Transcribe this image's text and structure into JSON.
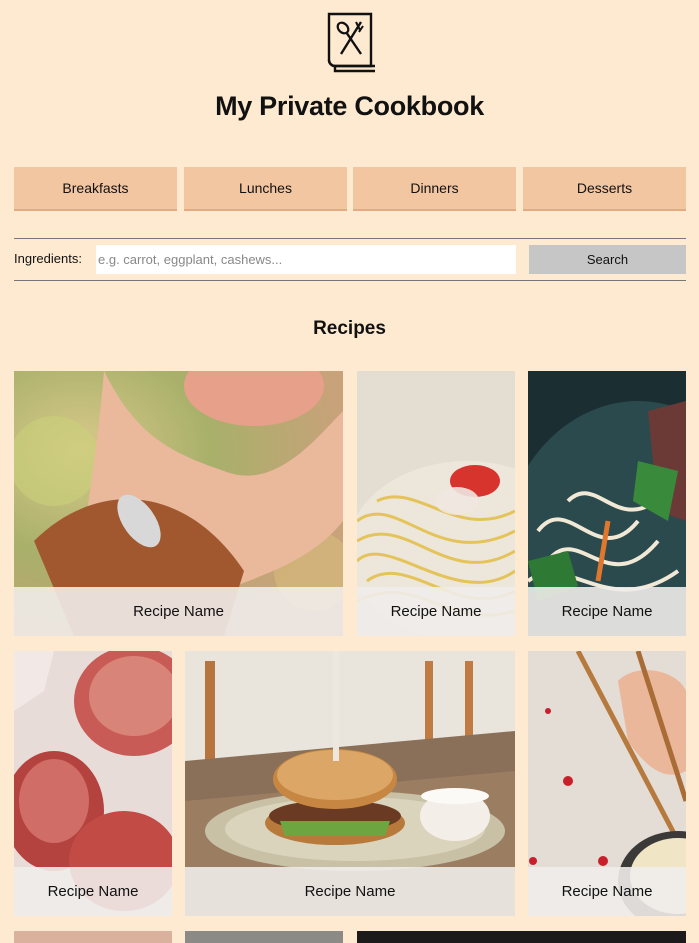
{
  "header": {
    "logo_icon": "cookbook-icon",
    "title": "My Private Cookbook"
  },
  "categories": [
    {
      "label": "Breakfasts"
    },
    {
      "label": "Lunches"
    },
    {
      "label": "Dinners"
    },
    {
      "label": "Desserts"
    }
  ],
  "search": {
    "label": "Ingredients:",
    "placeholder": "e.g. carrot, eggplant, cashews...",
    "value": "",
    "button_label": "Search"
  },
  "recipes": {
    "title": "Recipes",
    "items": [
      {
        "name": "Recipe Name",
        "photo": "peach-in-hand"
      },
      {
        "name": "Recipe Name",
        "photo": "spaghetti"
      },
      {
        "name": "Recipe Name",
        "photo": "noodle-bowl"
      },
      {
        "name": "Recipe Name",
        "photo": "crab"
      },
      {
        "name": "Recipe Name",
        "photo": "burger"
      },
      {
        "name": "Recipe Name",
        "photo": "chopsticks-noodles"
      }
    ]
  },
  "colors": {
    "background": "#feead0",
    "category_button": "#f3c6a2",
    "search_button": "#c6c6c6",
    "caption_bg": "#f0ecea"
  }
}
